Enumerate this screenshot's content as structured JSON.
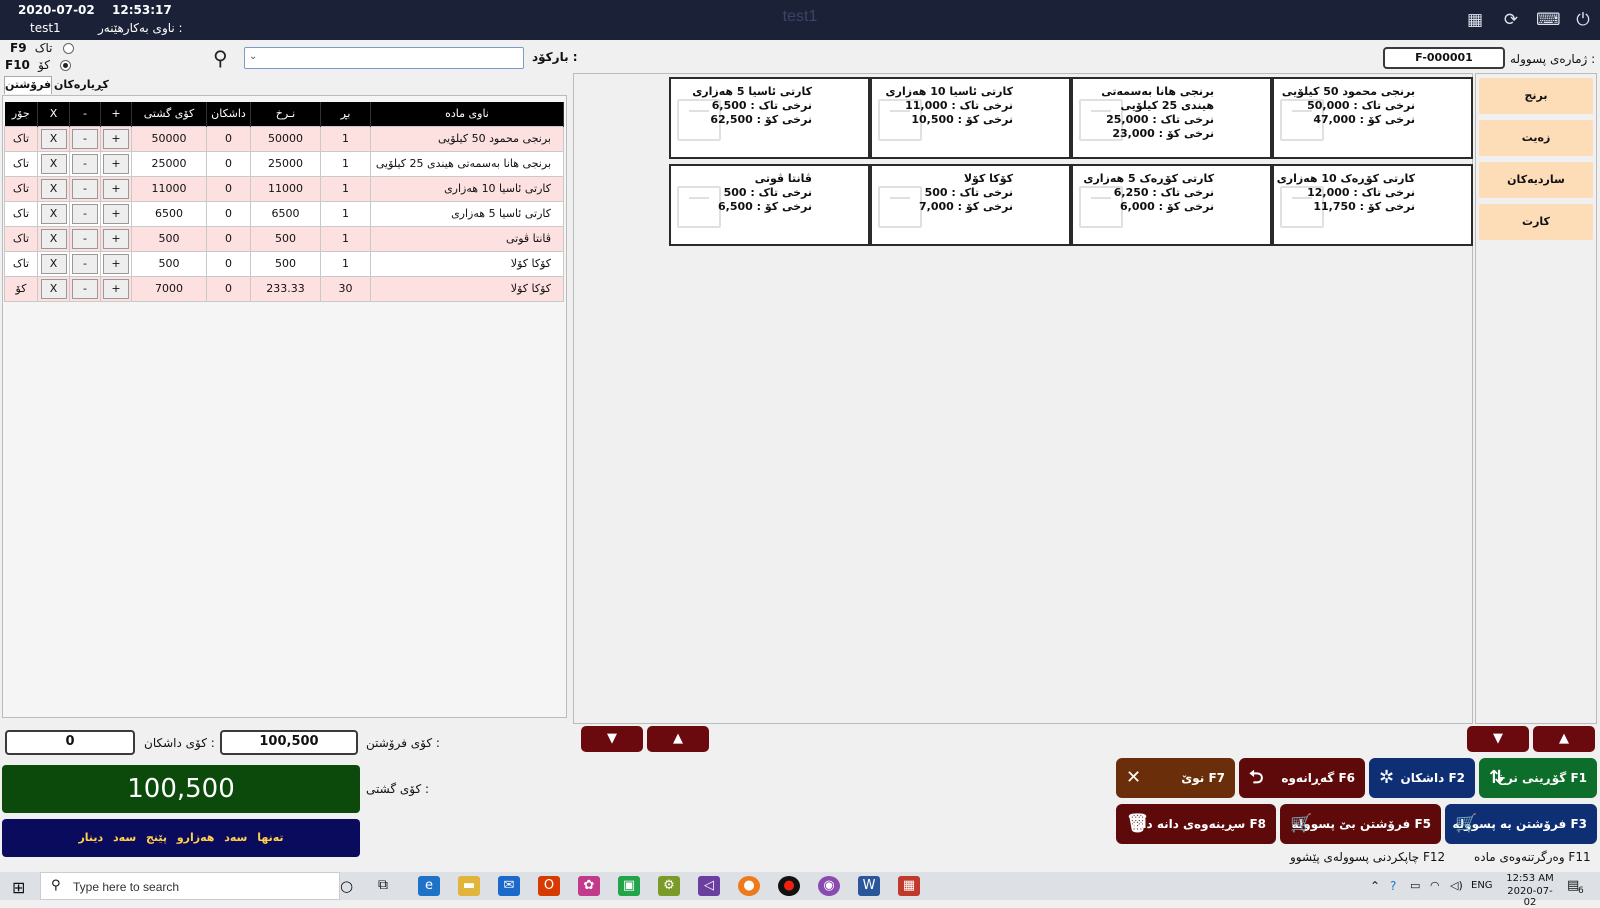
{
  "header": {
    "date": "2020-07-02",
    "time": "12:53:17",
    "user": "test1",
    "user_label": "ناوی بەکارهێنەر :",
    "window_title": "test1"
  },
  "top_icons": [
    "calculator-icon",
    "refresh-icon",
    "keyboard-icon",
    "power-icon"
  ],
  "sale_mode": {
    "option1_label": "تاک",
    "option1_key": "F9",
    "option2_label": "کۆ",
    "option2_key": "F10",
    "selected": "کۆ"
  },
  "barcode": {
    "label": "بارکۆد :",
    "value": ""
  },
  "invoice": {
    "label": "ژمارەی پسوولە :",
    "value": "F-000001"
  },
  "tabs": [
    "فرۆشتن",
    "کڕیارەکان"
  ],
  "table": {
    "headers": [
      "ناوی مادە",
      "بڕ",
      "نـرخ",
      "داشکان",
      "کۆی گشتی",
      "+",
      "-",
      "X",
      "جۆر"
    ],
    "rows": [
      {
        "name": "برنجی محمود 50 کیلۆیی",
        "qty": "1",
        "price": "50000",
        "discount": "0",
        "total": "50000",
        "type": "تاک"
      },
      {
        "name": "برنجی هانا بەسمەتی هیندی 25 کیلۆیی",
        "qty": "1",
        "price": "25000",
        "discount": "0",
        "total": "25000",
        "type": "تاک"
      },
      {
        "name": "کارتی ئاسیا 10 هەزاری",
        "qty": "1",
        "price": "11000",
        "discount": "0",
        "total": "11000",
        "type": "تاک"
      },
      {
        "name": "کارتی ئاسیا 5 هەزاری",
        "qty": "1",
        "price": "6500",
        "discount": "0",
        "total": "6500",
        "type": "تاک"
      },
      {
        "name": "ڤانتا ڤوتی",
        "qty": "1",
        "price": "500",
        "discount": "0",
        "total": "500",
        "type": "تاک"
      },
      {
        "name": "کۆکا کۆلا",
        "qty": "1",
        "price": "500",
        "discount": "0",
        "total": "500",
        "type": "تاک"
      },
      {
        "name": "کۆکا کۆلا",
        "qty": "30",
        "price": "233.33",
        "discount": "0",
        "total": "7000",
        "type": "کۆ"
      }
    ],
    "plus": "+",
    "minus": "-",
    "remove": "X"
  },
  "products": [
    {
      "name": "برنجی محمود 50 کیلۆیی",
      "single": "نرخی تاک : 50,000",
      "bulk": "نرخی کۆ : 47,000"
    },
    {
      "name": "برنجی هانا بەسمەتی هیندی 25 کیلۆیی",
      "single": "نرخی تاک : 25,000",
      "bulk": "نرخی کۆ : 23,000"
    },
    {
      "name": "کارتی ئاسیا 10 هەزاری",
      "single": "نرخی تاک : 11,000",
      "bulk": "نرخی کۆ : 10,500"
    },
    {
      "name": "کارتی ئاسیا 5 هەزاری",
      "single": "نرخی تاک : 6,500",
      "bulk": "نرخی کۆ : 62,500"
    },
    {
      "name": "کارتی کۆڕەک 10 هەزاری",
      "single": "نرخی تاک : 12,000",
      "bulk": "نرخی کۆ : 11,750"
    },
    {
      "name": "کارتی کۆڕەک 5 هەزاری",
      "single": "نرخی تاک : 6,250",
      "bulk": "نرخی کۆ : 6,000"
    },
    {
      "name": "کۆکا کۆلا",
      "single": "نرخی تاک : 500",
      "bulk": "نرخی کۆ : 7,000"
    },
    {
      "name": "ڤانتا ڤوتی",
      "single": "نرخی تاک : 500",
      "bulk": "نرخی کۆ : 6,500"
    }
  ],
  "categories": [
    "برنج",
    "زەیت",
    "ساردیەکان",
    "کارت"
  ],
  "totals": {
    "sales_label": "کۆی فرۆشتن :",
    "sales_value": "100,500",
    "discount_label": "کۆی داشکان :",
    "discount_value": "0",
    "grand_label": "کۆی گشتی :",
    "grand_value": "100,500",
    "words": "تەنها سەد هەزارو پێنج سەد دینار"
  },
  "function_buttons": {
    "f1": "گۆڕینی نرخ F1",
    "f2": "داشکان F2",
    "f6": "گەڕانەوە F6",
    "f7": "نوێ F7",
    "f3": "فرۆشتن بە پسوولە F3",
    "f5": "فرۆشتن بێ پسوولە F5",
    "f8": "سڕینەوەی دانە دانە F8",
    "f11": "وەرگرتنەوەی مادە F11",
    "f12": "چاپکردنی پسوولەی پێشوو F12"
  },
  "colors": {
    "header_bg": "#1b2238",
    "table_row_pink": "#fde0e0",
    "category_bg": "#fddcb8",
    "arrow_bg": "#6b0a0e",
    "total_bg": "#0b4a0b",
    "words_bg": "#0b0b5e",
    "btn_blue": "#0f2f74",
    "btn_green": "#0d6e2b",
    "btn_maroon": "#5e0a0a",
    "btn_brown": "#6b2e0a"
  },
  "taskbar": {
    "search_placeholder": "Type here to search",
    "lang": "ENG",
    "time": "12:53 AM",
    "date": "2020-07-02",
    "notif_count": "6"
  }
}
